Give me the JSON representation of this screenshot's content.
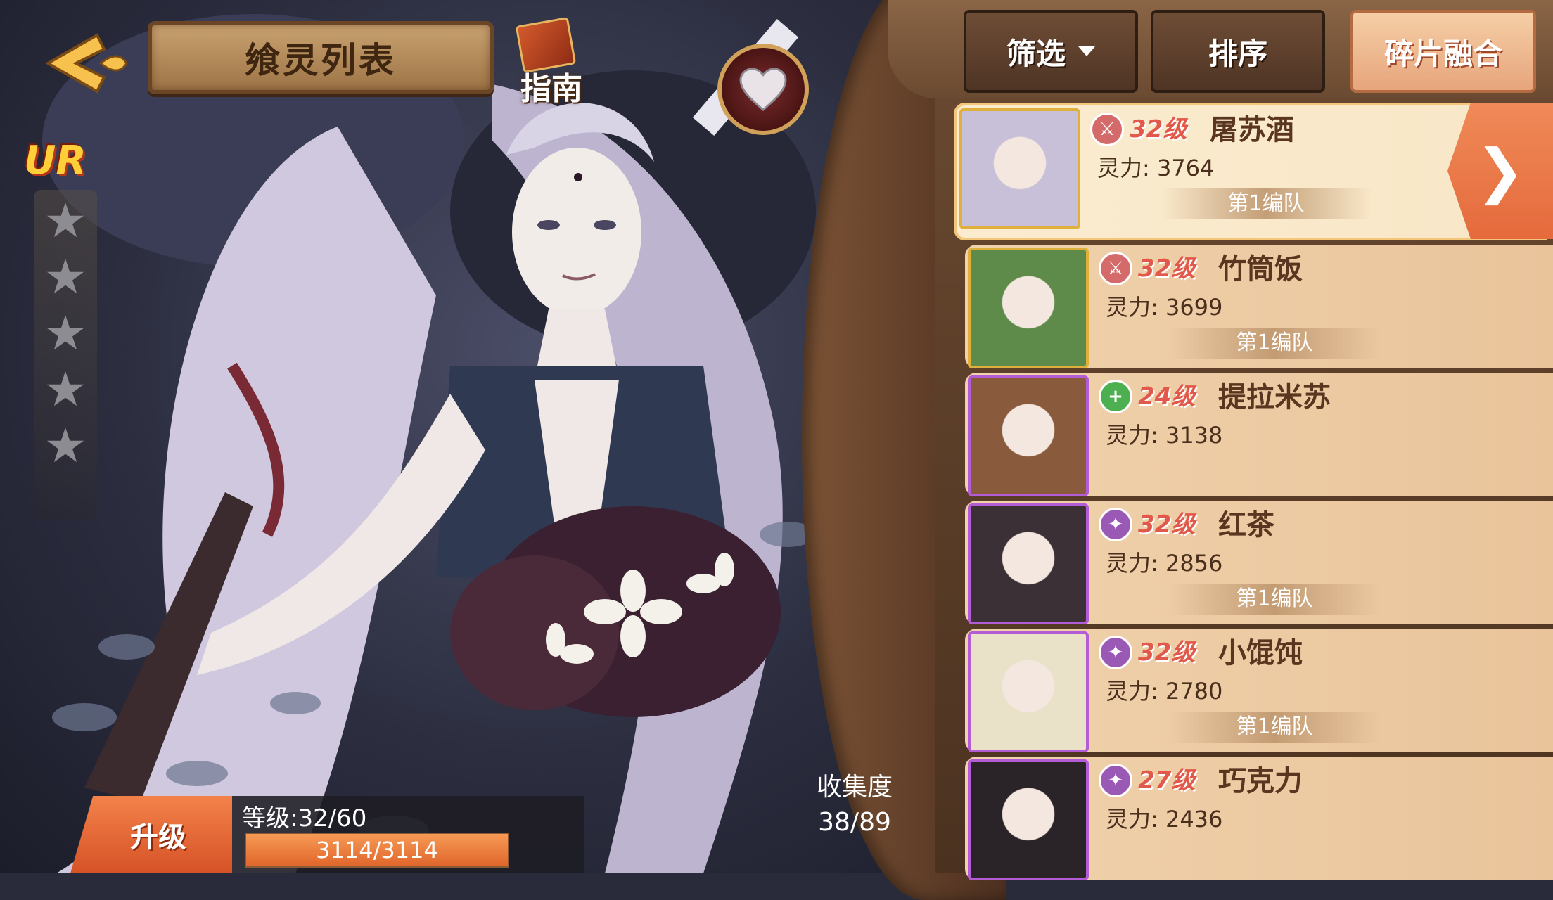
{
  "header": {
    "title": "飨灵列表",
    "guide_label": "指南"
  },
  "character": {
    "rarity": "UR",
    "stars_total": 5,
    "stars_filled": 0
  },
  "upgrade": {
    "label": "升级",
    "level_text": "等级:32/60",
    "exp_text": "3114/3114",
    "exp_fraction": 1.0
  },
  "collection": {
    "label": "收集度",
    "value": "38/89"
  },
  "toolbar": {
    "filter_label": "筛选",
    "sort_label": "排序",
    "fuse_label": "碎片融合"
  },
  "roster": [
    {
      "level": "32级",
      "name": "屠苏酒",
      "power": "灵力: 3764",
      "team": "第1编队",
      "job": "sword",
      "job_color": "#d46a6a",
      "frame": "gold",
      "selected": true
    },
    {
      "level": "32级",
      "name": "竹筒饭",
      "power": "灵力: 3699",
      "team": "第1编队",
      "job": "sword",
      "job_color": "#d46a6a",
      "frame": "gold",
      "selected": false
    },
    {
      "level": "24级",
      "name": "提拉米苏",
      "power": "灵力: 3138",
      "team": "",
      "job": "heal",
      "job_color": "#4caf50",
      "frame": "purple",
      "selected": false
    },
    {
      "level": "32级",
      "name": "红茶",
      "power": "灵力: 2856",
      "team": "第1编队",
      "job": "magic",
      "job_color": "#9b59b6",
      "frame": "purple",
      "selected": false
    },
    {
      "level": "32级",
      "name": "小馄饨",
      "power": "灵力: 2780",
      "team": "第1编队",
      "job": "magic",
      "job_color": "#9b59b6",
      "frame": "purple",
      "selected": false
    },
    {
      "level": "27级",
      "name": "巧克力",
      "power": "灵力: 2436",
      "team": "",
      "job": "magic",
      "job_color": "#9b59b6",
      "frame": "purple",
      "selected": false
    }
  ],
  "colors": {
    "accent": "#e56a3c",
    "gold": "#e0b03c",
    "purple": "#b45cd6",
    "level_red": "#e2584a"
  },
  "icons": {
    "back": "back-arrow-icon",
    "guide": "guide-book-icon",
    "favorite": "heart-icon",
    "star": "star-icon",
    "detail": "chevron-right-icon"
  }
}
